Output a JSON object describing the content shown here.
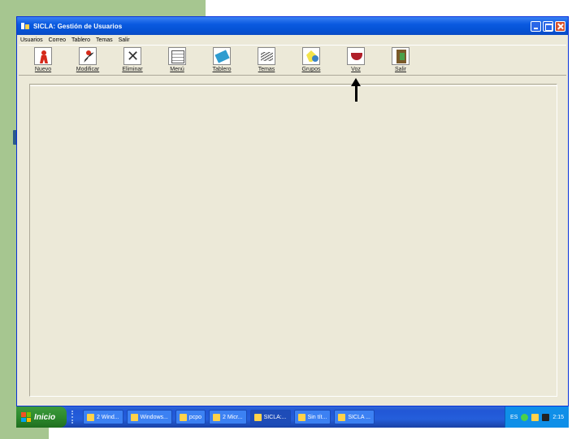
{
  "window": {
    "title": "SICLA: Gestión de Usuarios"
  },
  "menubar": {
    "items": [
      "Usuarios",
      "Correo",
      "Tablero",
      "Temas",
      "Salir"
    ]
  },
  "toolbar": {
    "buttons": [
      {
        "label": "Nuevo",
        "icon": "new-user-icon"
      },
      {
        "label": "Modificar",
        "icon": "edit-user-icon"
      },
      {
        "label": "Eliminar",
        "icon": "delete-user-icon"
      },
      {
        "label": "Menú",
        "icon": "menu-icon"
      },
      {
        "label": "Tablero",
        "icon": "board-icon"
      },
      {
        "label": "Temas",
        "icon": "themes-icon"
      },
      {
        "label": "Grupos",
        "icon": "groups-icon"
      },
      {
        "label": "Voz",
        "icon": "voice-icon"
      },
      {
        "label": "Salir",
        "icon": "exit-icon"
      }
    ]
  },
  "taskbar": {
    "start_label": "Inicio",
    "tasks": [
      "2 Wind...",
      "Windows...",
      "pcpo",
      "2 Micr...",
      "SICLA:...",
      "Sin tít...",
      "SICLA ..."
    ],
    "tray_lang": "ES",
    "clock": "2:15"
  }
}
